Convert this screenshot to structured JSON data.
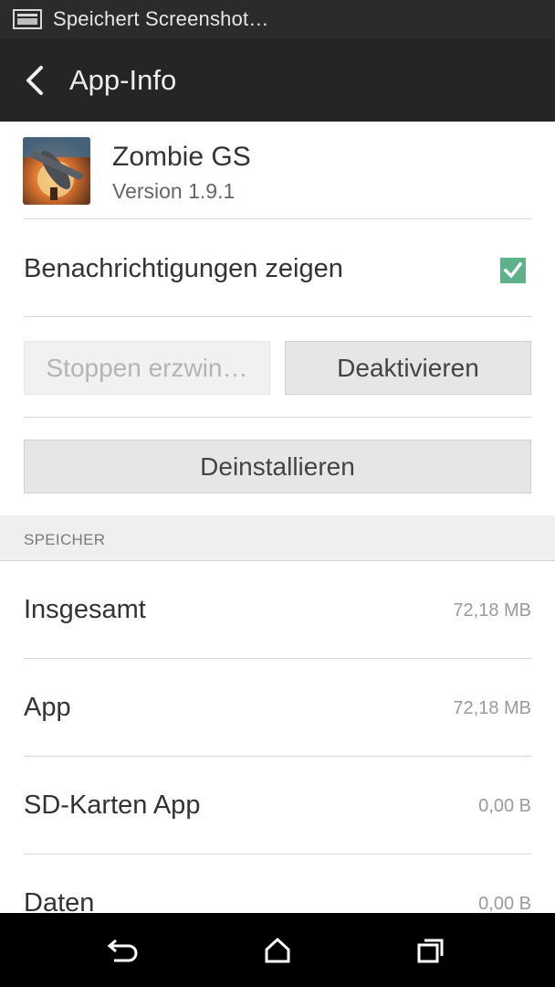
{
  "status_bar": {
    "notification_text": "Speichert Screenshot…",
    "icon": "screenshot-icon"
  },
  "app_bar": {
    "title": "App-Info",
    "back_icon": "back-arrow-icon"
  },
  "app": {
    "name": "Zombie GS",
    "version": "Version 1.9.1",
    "icon": "app-icon"
  },
  "notifications": {
    "label": "Benachrichtigungen zeigen",
    "checked": true,
    "check_color": "#5fb18a"
  },
  "buttons": {
    "force_stop": "Stoppen erzwin…",
    "deactivate": "Deaktivieren",
    "uninstall": "Deinstallieren"
  },
  "storage": {
    "header": "SPEICHER",
    "rows": [
      {
        "label": "Insgesamt",
        "value": "72,18 MB"
      },
      {
        "label": "App",
        "value": "72,18 MB"
      },
      {
        "label": "SD-Karten App",
        "value": "0,00 B"
      },
      {
        "label": "Daten",
        "value": "0,00 B"
      }
    ]
  },
  "nav_bar": {
    "back_icon": "back-icon",
    "home_icon": "home-icon",
    "recents_icon": "recents-icon"
  },
  "colors": {
    "status_bar_bg": "#2b2b2b",
    "app_bar_bg": "#252525",
    "accent_green": "#5fb18a"
  }
}
